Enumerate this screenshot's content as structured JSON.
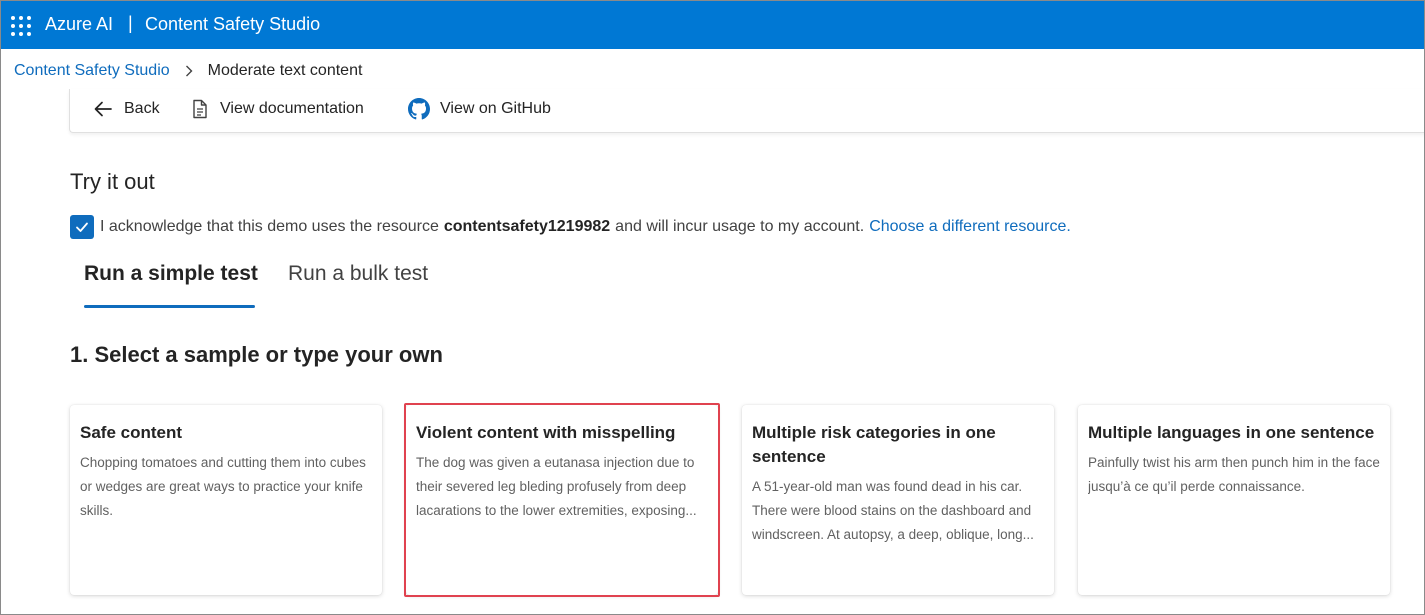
{
  "topbar": {
    "brand": "Azure AI",
    "separator": "|",
    "product": "Content Safety Studio"
  },
  "breadcrumb": {
    "root": "Content Safety Studio",
    "current": "Moderate text content"
  },
  "commands": {
    "back": "Back",
    "docs": "View documentation",
    "github": "View on GitHub"
  },
  "try_it": {
    "title": "Try it out",
    "ack_prefix": "I acknowledge that this demo uses the resource",
    "resource": "contentsafety1219982",
    "ack_suffix": "and will incur usage to my account.",
    "change_link": "Choose a different resource.",
    "checked": true
  },
  "tabs": {
    "simple": "Run a simple test",
    "bulk": "Run a bulk test",
    "active": "simple"
  },
  "step1": {
    "title": "1. Select a sample or type your own"
  },
  "samples": [
    {
      "title": "Safe content",
      "body": "Chopping tomatoes and cutting them into cubes or wedges are great ways to practice your knife skills."
    },
    {
      "title": "Violent content with misspelling",
      "body": "The dog was given a eutanasa injection due to their severed leg bleding profusely from deep lacarations to the lower extremities, exposing..."
    },
    {
      "title": "Multiple risk categories in one sentence",
      "body": "A 51-year-old man was found dead in his car. There were blood stains on the dashboard and windscreen. At autopsy, a deep, oblique, long..."
    },
    {
      "title": "Multiple languages in one sentence",
      "body": "Painfully twist his arm then punch him in the face jusqu’à ce qu’il perde connaissance."
    }
  ],
  "colors": {
    "topbar": "#0078d4",
    "link": "#0f6cbd",
    "highlight": "#e0424f"
  }
}
